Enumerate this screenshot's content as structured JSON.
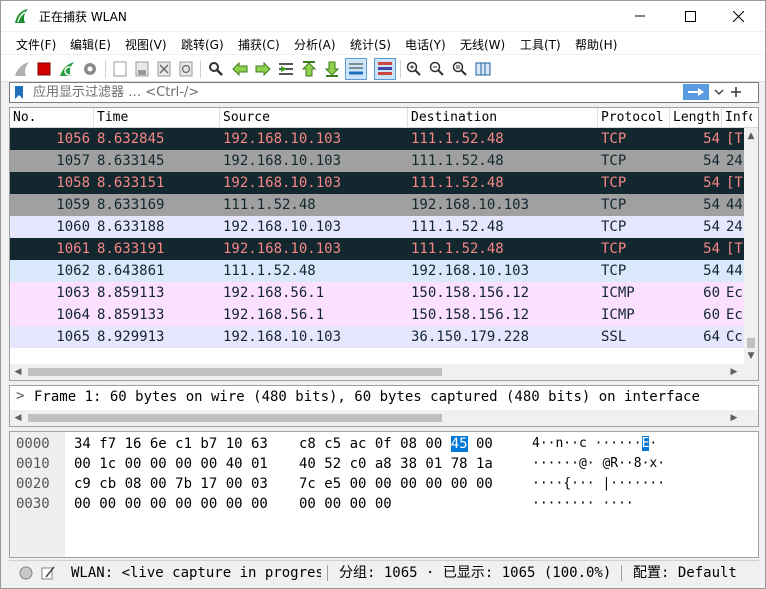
{
  "window": {
    "title": "正在捕获 WLAN"
  },
  "menu": [
    "文件(F)",
    "编辑(E)",
    "视图(V)",
    "跳转(G)",
    "捕获(C)",
    "分析(A)",
    "统计(S)",
    "电话(Y)",
    "无线(W)",
    "工具(T)",
    "帮助(H)"
  ],
  "toolbar": {
    "icons": [
      "shark-fin-icon",
      "stop-icon",
      "restart-icon",
      "options-gear-icon",
      "open-file-icon",
      "save-file-icon",
      "close-file-icon",
      "reload-icon",
      "find-packet-icon",
      "go-back-icon",
      "go-forward-icon",
      "go-to-packet-icon",
      "go-first-icon",
      "go-last-icon",
      "autoscroll-icon",
      "colorize-icon",
      "zoom-in-icon",
      "zoom-out-icon",
      "zoom-normal-icon",
      "resize-columns-icon"
    ]
  },
  "filter": {
    "placeholder": "应用显示过滤器 … <Ctrl-/>"
  },
  "columns": [
    "No.",
    "Time",
    "Source",
    "Destination",
    "Protocol",
    "Length",
    "Info"
  ],
  "packets": [
    {
      "no": "1056",
      "time": "8.632845",
      "src": "192.168.10.103",
      "dst": "111.1.52.48",
      "proto": "TCP",
      "len": "54",
      "info": "[T",
      "style": "dark"
    },
    {
      "no": "1057",
      "time": "8.633145",
      "src": "192.168.10.103",
      "dst": "111.1.52.48",
      "proto": "TCP",
      "len": "54",
      "info": "24",
      "style": "gray"
    },
    {
      "no": "1058",
      "time": "8.633151",
      "src": "192.168.10.103",
      "dst": "111.1.52.48",
      "proto": "TCP",
      "len": "54",
      "info": "[T",
      "style": "dark"
    },
    {
      "no": "1059",
      "time": "8.633169",
      "src": "111.1.52.48",
      "dst": "192.168.10.103",
      "proto": "TCP",
      "len": "54",
      "info": "44",
      "style": "gray"
    },
    {
      "no": "1060",
      "time": "8.633188",
      "src": "192.168.10.103",
      "dst": "111.1.52.48",
      "proto": "TCP",
      "len": "54",
      "info": "24",
      "style": "lav"
    },
    {
      "no": "1061",
      "time": "8.633191",
      "src": "192.168.10.103",
      "dst": "111.1.52.48",
      "proto": "TCP",
      "len": "54",
      "info": "[T",
      "style": "dark"
    },
    {
      "no": "1062",
      "time": "8.643861",
      "src": "111.1.52.48",
      "dst": "192.168.10.103",
      "proto": "TCP",
      "len": "54",
      "info": "44",
      "style": "blue"
    },
    {
      "no": "1063",
      "time": "8.859113",
      "src": "192.168.56.1",
      "dst": "150.158.156.12",
      "proto": "ICMP",
      "len": "60",
      "info": "Ec",
      "style": "pink"
    },
    {
      "no": "1064",
      "time": "8.859133",
      "src": "192.168.56.1",
      "dst": "150.158.156.12",
      "proto": "ICMP",
      "len": "60",
      "info": "Ec",
      "style": "pink"
    },
    {
      "no": "1065",
      "time": "8.929913",
      "src": "192.168.10.103",
      "dst": "36.150.179.228",
      "proto": "SSL",
      "len": "64",
      "info": "Cc",
      "style": "lav"
    }
  ],
  "detail": {
    "expander": ">",
    "line": "Frame 1: 60 bytes on wire (480 bits), 60 bytes captured (480 bits) on interface"
  },
  "bytes": {
    "offsets": [
      "0000",
      "0010",
      "0020",
      "0030"
    ],
    "hex_left": [
      "34 f7 16 6e c1 b7 10 63",
      "00 1c 00 00 00 00 40 01",
      "c9 cb 08 00 7b 17 00 03",
      "00 00 00 00 00 00 00 00"
    ],
    "hex_right": [
      "c8 c5 ac 0f 08 00 45 00",
      "40 52 c0 a8 38 01 78 1a",
      "7c e5 00 00 00 00 00 00",
      "00 00 00 00"
    ],
    "highlight_byte": "45",
    "ascii": [
      "4··n··c ······E·",
      "······@· @R··8·x·",
      "····{··· |·······",
      "········ ····"
    ]
  },
  "status": {
    "interface": "WLAN: <live capture in progress",
    "packets": "分组: 1065 · 已显示: 1065 (100.0%)",
    "profile": "配置: Default"
  },
  "colors": {
    "dark_bg": "#12272e",
    "dark_fg": "#f78787",
    "gray_bg": "#a0a0a0",
    "lav_bg": "#e7e6ff",
    "blue_bg": "#dae8fc",
    "pink_bg": "#fce0ff",
    "highlight": "#0078d7"
  }
}
